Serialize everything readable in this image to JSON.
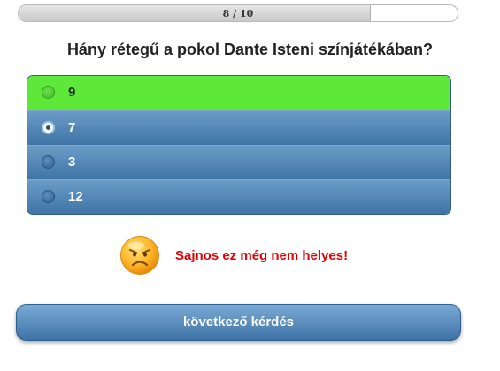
{
  "progress": {
    "text": "8 / 10",
    "current": 8,
    "total": 10
  },
  "question": {
    "text": "Hány rétegű a pokol Dante Isteni színjátékában?"
  },
  "answers": [
    {
      "label": "9",
      "state": "correct",
      "selected": false
    },
    {
      "label": "7",
      "state": "wrong",
      "selected": true
    },
    {
      "label": "3",
      "state": "normal",
      "selected": false
    },
    {
      "label": "12",
      "state": "normal",
      "selected": false
    }
  ],
  "feedback": {
    "icon": "sad-face-icon",
    "message": "Sajnos ez még nem helyes!",
    "color": "#e00000"
  },
  "next_button": {
    "label": "következő kérdés"
  },
  "colors": {
    "correct": "#5ee93a",
    "answer": "#4f84b5",
    "accent": "#3e72a6"
  }
}
